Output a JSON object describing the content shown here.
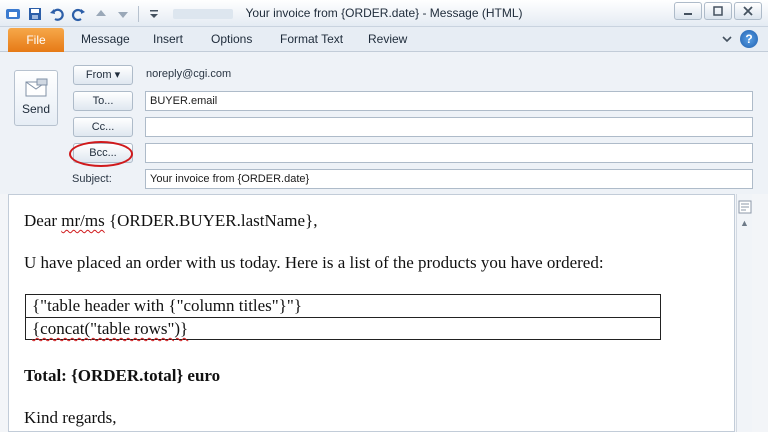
{
  "window": {
    "title": "Your invoice from {ORDER.date} - Message (HTML)"
  },
  "ribbon": {
    "tabs": [
      "File",
      "Message",
      "Insert",
      "Options",
      "Format Text",
      "Review"
    ]
  },
  "header": {
    "send_label": "Send",
    "from_label": "From",
    "from_value": "noreply@cgi.com",
    "to_label": "To...",
    "to_value": "BUYER.email",
    "cc_label": "Cc...",
    "cc_value": "",
    "bcc_label": "Bcc...",
    "bcc_value": "",
    "subject_label": "Subject:",
    "subject_value": "Your invoice from {ORDER.date}"
  },
  "body": {
    "greeting_prefix": "Dear ",
    "greeting_mr": "mr/ms",
    "greeting_suffix": " {ORDER.BUYER.lastName},",
    "intro": "U have placed an order with us today. Here is a list of the products you have ordered:",
    "table_header": "{\"table header with {\"column titles\"}\"}",
    "table_rows": "{concat(\"table rows\")}",
    "total_label": "Total: ",
    "total_value": "{ORDER.total}",
    "total_unit": " euro",
    "closing": "Kind regards,"
  },
  "colors": {
    "file_tab": "#e67a16",
    "highlight_circle": "#d0191b"
  }
}
